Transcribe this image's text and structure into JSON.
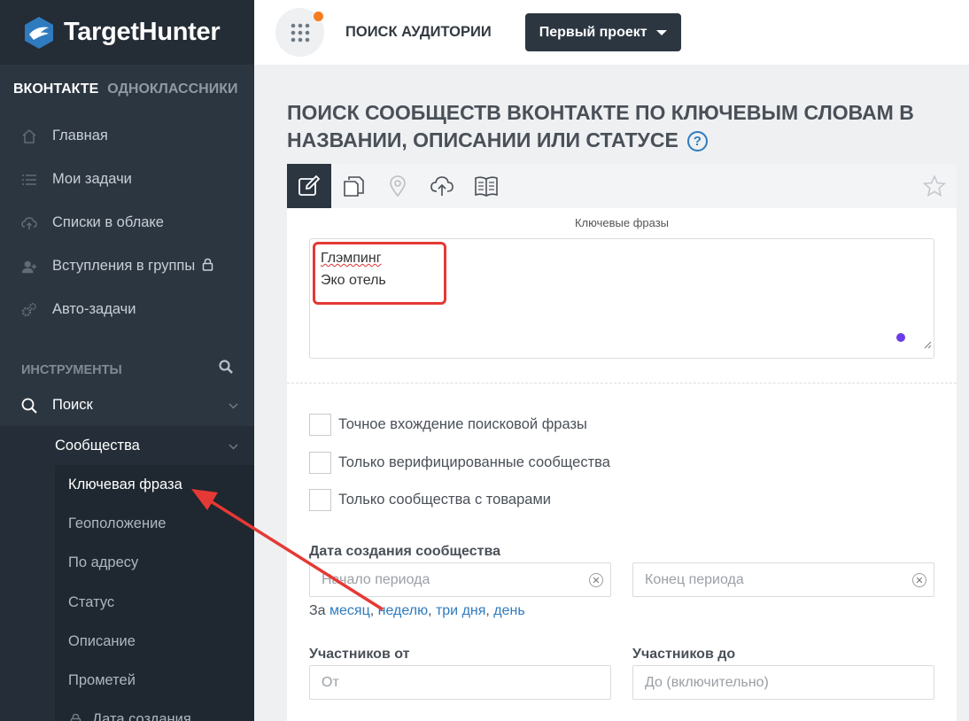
{
  "app": {
    "logo_text": "TargetHunter",
    "network_tabs": [
      "ВКОНТАКТЕ",
      "ОДНОКЛАССНИКИ"
    ]
  },
  "sidebar": {
    "items": [
      {
        "label": "Главная",
        "icon": "home-icon"
      },
      {
        "label": "Мои задачи",
        "icon": "list-icon"
      },
      {
        "label": "Списки в облаке",
        "icon": "cloud-upload-icon"
      },
      {
        "label": "Вступления в группы",
        "icon": "user-add-icon",
        "locked": true
      },
      {
        "label": "Авто-задачи",
        "icon": "gears-icon"
      }
    ],
    "tools_heading": "ИНСТРУМЕНТЫ",
    "search_label": "Поиск",
    "communities_label": "Сообщества",
    "sub_items": [
      "Ключевая фраза",
      "Геоположение",
      "По адресу",
      "Статус",
      "Описание",
      "Прометей",
      "Дата создания"
    ],
    "active_sub_item": "Ключевая фраза"
  },
  "topbar": {
    "title": "ПОИСК АУДИТОРИИ",
    "project": "Первый проект"
  },
  "main": {
    "title": "ПОИСК СООБЩЕСТВ ВКОНТАКТЕ ПО КЛЮЧЕВЫМ СЛОВАМ В НАЗВАНИИ, ОПИСАНИИ ИЛИ СТАТУСЕ",
    "help": "?",
    "tab_icons": [
      "edit-icon",
      "copy-icon",
      "map-pin-icon",
      "cloud-upload-icon",
      "book-icon"
    ],
    "keywords_label": "Ключевые фразы",
    "keywords": [
      "Глэмпинг",
      "Эко отель"
    ],
    "checkboxes": [
      "Точное вхождение поисковой фразы",
      "Только верифицированные сообщества",
      "Только сообщества с товарами"
    ],
    "date_label": "Дата создания сообщества",
    "date_start_placeholder": "Начало периода",
    "date_end_placeholder": "Конец периода",
    "quick_prefix": "За",
    "quick_links": [
      "месяц",
      "неделю",
      "три дня",
      "день"
    ],
    "members_from_label": "Участников от",
    "members_to_label": "Участников до",
    "members_from_placeholder": "От",
    "members_to_placeholder": "До (включительно)"
  },
  "colors": {
    "sidebar_bg": "#2c3641",
    "accent": "#2f7bbf",
    "highlight": "#e53935",
    "notification": "#f57c1f"
  }
}
